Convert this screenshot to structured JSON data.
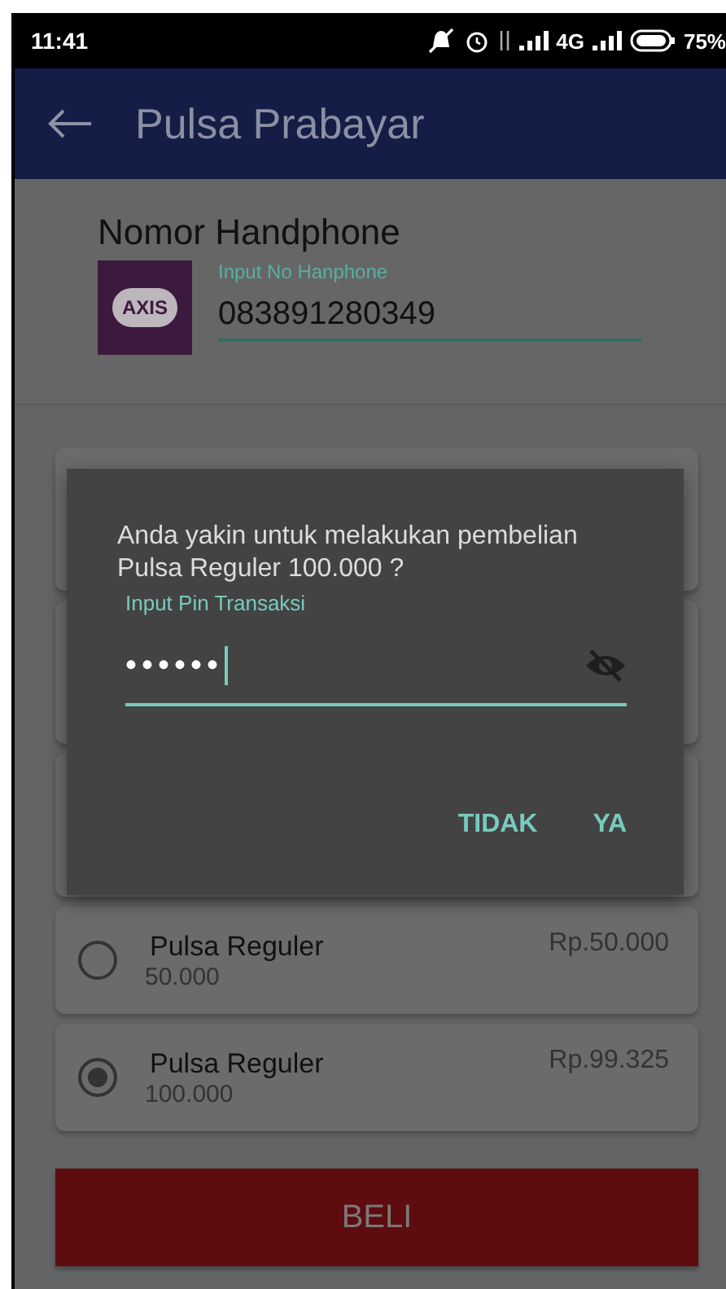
{
  "status_bar": {
    "time": "11:41",
    "network": "4G",
    "battery": "75%"
  },
  "app_bar": {
    "title": "Pulsa Prabayar"
  },
  "phone": {
    "heading": "Nomor Handphone",
    "label": "Input No Hanphone",
    "value": "083891280349",
    "operator_logo": "AXIS"
  },
  "products": [
    {
      "name": "Pulsa Reguler",
      "amount": "50.000",
      "price": "Rp.50.000",
      "selected": false
    },
    {
      "name": "Pulsa Reguler",
      "amount": "100.000",
      "price": "Rp.99.325",
      "selected": true
    }
  ],
  "buy_button": "BELI",
  "dialog": {
    "message": "Anda yakin untuk melakukan pembelian Pulsa Reguler 100.000 ?",
    "pin_label": "Input Pin Transaksi",
    "pin_value": "••••••",
    "buttons": [
      "TIDAK",
      "YA"
    ]
  }
}
